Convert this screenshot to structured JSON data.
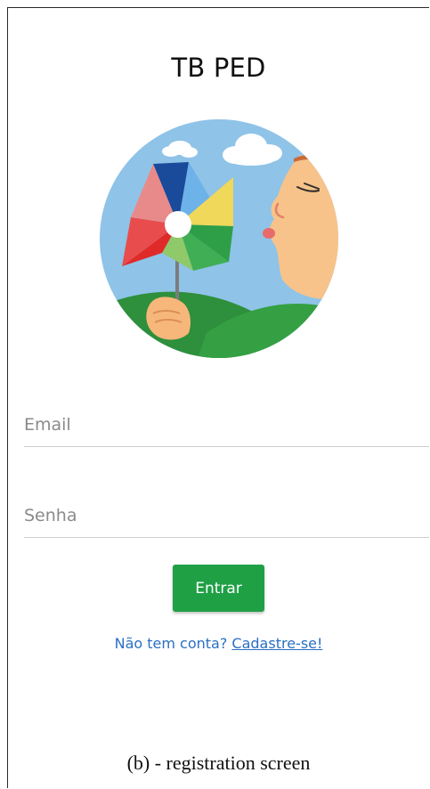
{
  "app": {
    "title": "TB PED"
  },
  "form": {
    "email": {
      "placeholder": "Email",
      "value": ""
    },
    "password": {
      "placeholder": "Senha",
      "value": ""
    },
    "submit_label": "Entrar"
  },
  "signup": {
    "prompt": "Não tem conta?",
    "link_label": "Cadastre-se!"
  },
  "caption": "(b) - registration screen",
  "colors": {
    "accent_green": "#1fa045",
    "link_blue": "#2a6fc4",
    "sky": "#8fc3e8"
  },
  "illustration": {
    "icon": "child-blowing-pinwheel-icon"
  }
}
